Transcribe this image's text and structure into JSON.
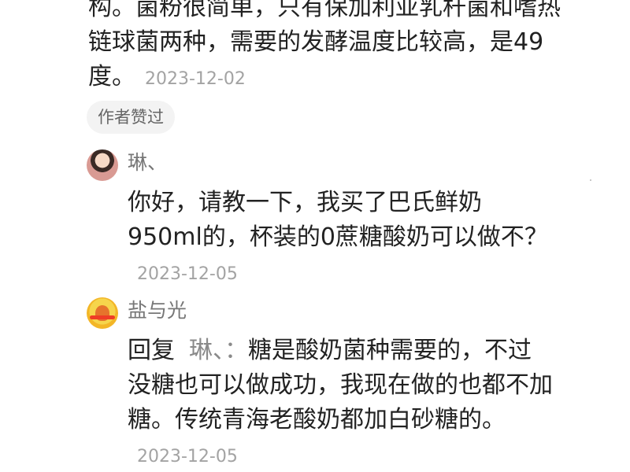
{
  "comments": {
    "top": {
      "text": "构。菌粉很简单，只有保加利亚乳杆菌和嗜热链球菌两种，需要的发酵温度比较高，是49度。",
      "date": "2023-12-02",
      "badge": "作者赞过"
    },
    "replies": [
      {
        "name": "琳、",
        "avatar_icon": "profile-photo-icon",
        "text": "你好，请教一下，我买了巴氏鲜奶950ml的，杯装的0蔗糖酸奶可以做不？",
        "date": "2023-12-05"
      },
      {
        "name": "盐与光",
        "avatar_icon": "yellow-cartoon-avatar-icon",
        "reply_prefix": "回复",
        "reply_target": "琳、：",
        "text": "糖是酸奶菌种需要的，不过没糖也可以做成功，我现在做的也都不加糖。传统青海老酸奶都加白砂糖的。",
        "date": "2023-12-05"
      }
    ]
  },
  "colors": {
    "text": "#222222",
    "muted": "#a3a3a3",
    "badge_bg": "#f3f3f3"
  }
}
